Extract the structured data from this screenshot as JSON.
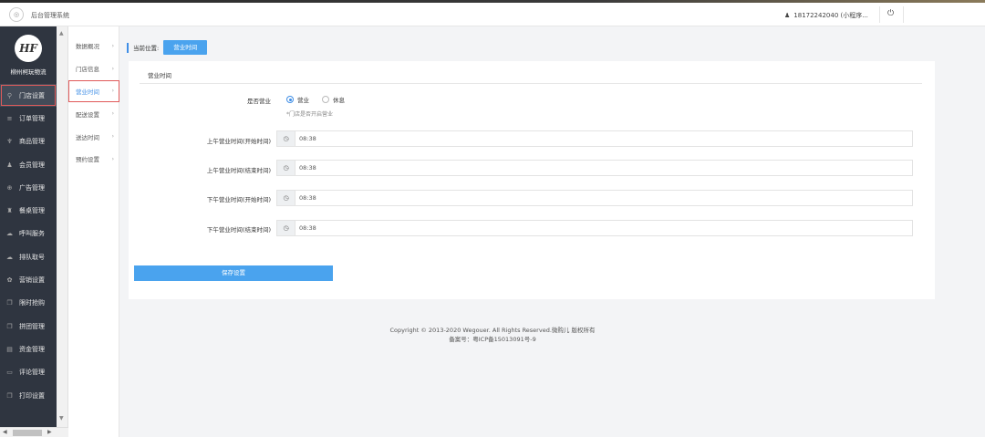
{
  "topbar": {
    "title": "后台管理系统",
    "user": "18172242040 (小程序...",
    "user_icon": "person-icon",
    "power_icon": "power-icon"
  },
  "sidebar": {
    "brand_logo": "HF",
    "brand_name": "柳州柯玩物流",
    "items": [
      {
        "label": "门店设置",
        "icon": "key-icon",
        "active": true
      },
      {
        "label": "订单管理",
        "icon": "list-icon"
      },
      {
        "label": "商品管理",
        "icon": "trophy-icon"
      },
      {
        "label": "会员管理",
        "icon": "user-icon"
      },
      {
        "label": "广告管理",
        "icon": "target-icon"
      },
      {
        "label": "餐桌管理",
        "icon": "dining-icon"
      },
      {
        "label": "呼叫服务",
        "icon": "cloud-icon"
      },
      {
        "label": "排队取号",
        "icon": "cloud-icon"
      },
      {
        "label": "营销设置",
        "icon": "gift-icon"
      },
      {
        "label": "限时抢购",
        "icon": "copy-icon"
      },
      {
        "label": "拼团管理",
        "icon": "copy-icon"
      },
      {
        "label": "资金管理",
        "icon": "wallet-icon"
      },
      {
        "label": "评论管理",
        "icon": "chat-icon"
      },
      {
        "label": "打印设置",
        "icon": "copy-icon"
      }
    ]
  },
  "submenu": {
    "items": [
      {
        "label": "数据概况"
      },
      {
        "label": "门店信息"
      },
      {
        "label": "营业时间",
        "active": true
      },
      {
        "label": "配送设置"
      },
      {
        "label": "送达时间"
      },
      {
        "label": "预约设置"
      }
    ]
  },
  "breadcrumb": {
    "label": "当前位置:",
    "current": "营业时间"
  },
  "panel": {
    "title": "营业时间",
    "open_label": "是否营业",
    "radio_open": "营业",
    "radio_closed": "休息",
    "hint": "*门店是否开启营业",
    "fields": [
      {
        "label": "上午营业时间(开始时间)",
        "value": "08:38"
      },
      {
        "label": "上午营业时间(结束时间)",
        "value": "08:38"
      },
      {
        "label": "下午营业时间(开始时间)",
        "value": "08:38"
      },
      {
        "label": "下午营业时间(结束时间)",
        "value": "08:38"
      }
    ],
    "save_label": "保存设置"
  },
  "footer": {
    "copyright": "Copyright © 2013-2020 Wegouer. All Rights Reserved.微购儿 版权所有",
    "icp": "备案号：粤ICP备15013091号-9"
  },
  "colors": {
    "sidebar_bg": "#2f3540",
    "accent": "#4aa3ee",
    "highlight_outline": "#e05a5a"
  }
}
